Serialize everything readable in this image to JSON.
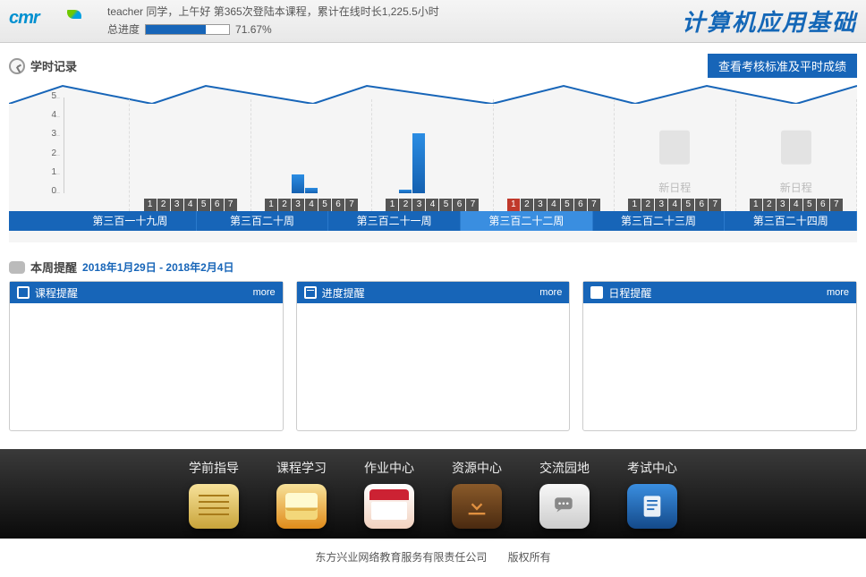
{
  "header": {
    "logo_text": "cmr",
    "greeting": "teacher 同学，上午好 第365次登陆本课程，累计在线时长1,225.5小时",
    "progress_label": "总进度",
    "progress_pct": 71.67,
    "progress_text": "71.67%",
    "course_title": "计算机应用基础"
  },
  "study_record": {
    "title": "学时记录",
    "view_button": "查看考核标准及平时成绩"
  },
  "chart_data": {
    "type": "bar",
    "ylabel": "hours",
    "ylim": [
      0,
      5
    ],
    "y_ticks": [
      0,
      1,
      2,
      3,
      4,
      5
    ],
    "day_labels": [
      "1",
      "2",
      "3",
      "4",
      "5",
      "6",
      "7"
    ],
    "weeks": [
      {
        "label": "第三百一十九周",
        "bars": [
          0,
          0,
          0,
          0,
          0,
          0,
          0
        ],
        "has_data": true,
        "today_idx": -1
      },
      {
        "label": "第三百二十周",
        "bars": [
          0,
          0,
          1.0,
          0.3,
          0,
          0,
          0
        ],
        "has_data": true,
        "today_idx": -1
      },
      {
        "label": "第三百二十一周",
        "bars": [
          0,
          0.2,
          3.2,
          0,
          0,
          0,
          0
        ],
        "has_data": true,
        "today_idx": -1
      },
      {
        "label": "第三百二十二周",
        "bars": [
          0,
          0,
          0,
          0,
          0,
          0,
          0
        ],
        "has_data": true,
        "today_idx": 0,
        "current": true
      },
      {
        "label": "第三百二十三周",
        "bars": [],
        "has_data": false,
        "placeholder": "新日程",
        "today_idx": -1
      },
      {
        "label": "第三百二十四周",
        "bars": [],
        "has_data": false,
        "placeholder": "新日程",
        "today_idx": -1
      }
    ]
  },
  "reminder": {
    "section_title": "本周提醒",
    "date_range": "2018年1月29日 - 2018年2月4日",
    "panels": [
      {
        "title": "课程提醒",
        "more": "more"
      },
      {
        "title": "进度提醒",
        "more": "more"
      },
      {
        "title": "日程提醒",
        "more": "more"
      }
    ]
  },
  "nav": [
    {
      "label": "学前指导",
      "icon": "notes-icon"
    },
    {
      "label": "课程学习",
      "icon": "book-icon"
    },
    {
      "label": "作业中心",
      "icon": "calendar-icon"
    },
    {
      "label": "资源中心",
      "icon": "download-icon"
    },
    {
      "label": "交流园地",
      "icon": "chat-icon"
    },
    {
      "label": "考试中心",
      "icon": "exam-icon"
    }
  ],
  "footer": {
    "company": "东方兴业网络教育服务有限责任公司",
    "copyright": "版权所有"
  }
}
